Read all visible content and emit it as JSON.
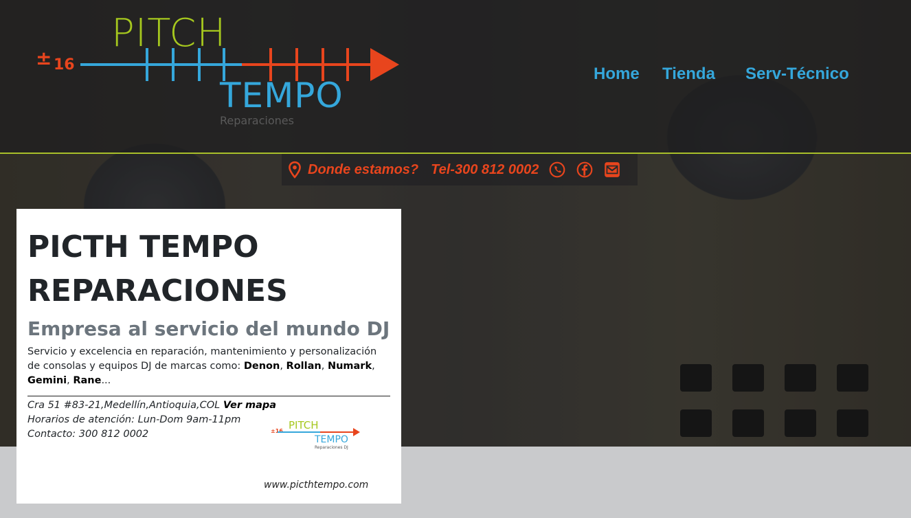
{
  "colors": {
    "accent_blue": "#35a7db",
    "accent_orange": "#e8451d",
    "accent_green": "#a6c81e",
    "divider": "#a9c02a"
  },
  "brand": {
    "pitch": "PITCH",
    "tempo": "TEMPO",
    "sub": "Reparaciones",
    "sign": "±",
    "number": "16"
  },
  "nav": {
    "items": [
      {
        "label": "Home"
      },
      {
        "label": "Tienda"
      },
      {
        "label": "Serv-Técnico"
      }
    ]
  },
  "infobar": {
    "location_icon": "map-pin-icon",
    "location_label": "Donde estamos?",
    "phone_label": "Tel-300 812 0002",
    "whatsapp_icon": "whatsapp-icon",
    "facebook_icon": "facebook-icon",
    "mail_icon": "mail-icon"
  },
  "card": {
    "title_line1": "PICTH TEMPO",
    "title_line2": "REPARACIONES",
    "subtitle": "Empresa al servicio del mundo DJ",
    "desc_intro": "Servicio y excelencia en reparación, mantenimiento y personalización de consolas y equipos DJ de marcas como: ",
    "brands": [
      "Denon",
      "Rollan",
      "Numark",
      "Gemini",
      "Rane"
    ],
    "sep": ", ",
    "ellipsis": "...",
    "address": "Cra 51 #83-21,Medellín,Antioquia,COL ",
    "map_link": "Ver mapa",
    "hours": "Horarios de atención: Lun-Dom 9am-11pm",
    "contact": "Contacto: 300 812 0002",
    "website": "www.picthtempo.com",
    "mini_logo": {
      "pitch": "PITCH",
      "tempo": "TEMPO",
      "sub": "Reparaciones DJ",
      "number": "±16"
    }
  }
}
